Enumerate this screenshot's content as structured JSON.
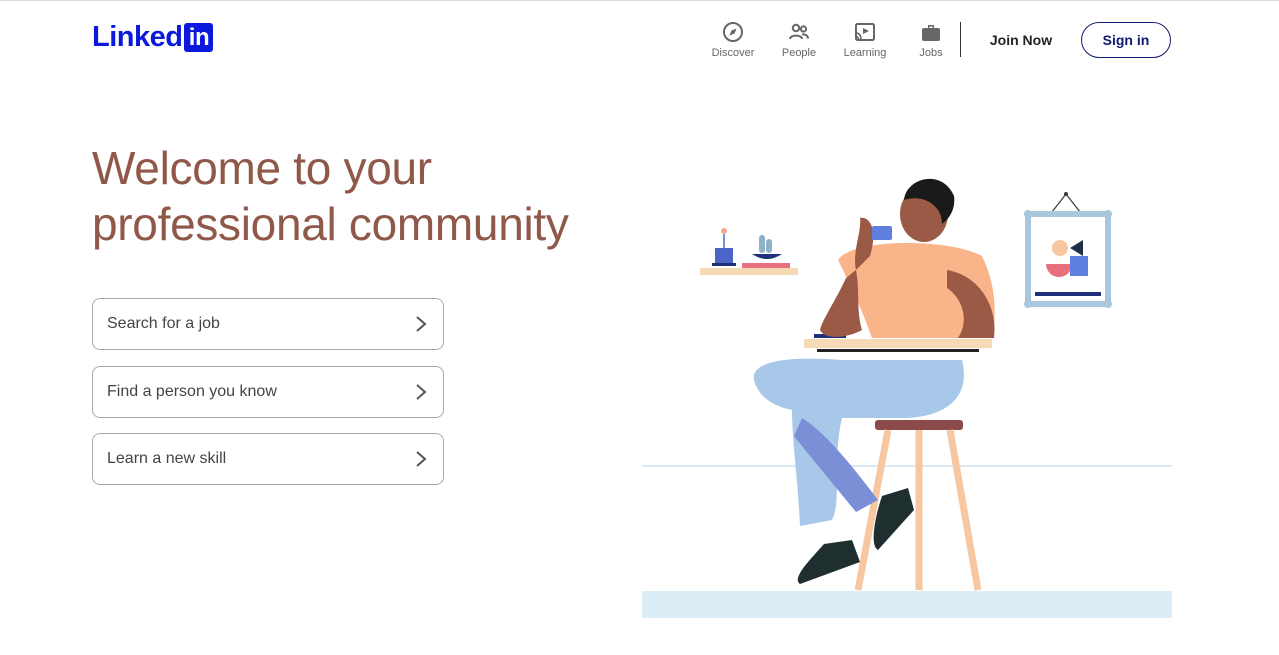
{
  "header": {
    "logo_text": "Linked",
    "logo_box": "in",
    "nav": [
      {
        "label": "Discover",
        "icon": "compass-icon"
      },
      {
        "label": "People",
        "icon": "people-icon"
      },
      {
        "label": "Learning",
        "icon": "learning-icon"
      },
      {
        "label": "Jobs",
        "icon": "briefcase-icon"
      }
    ],
    "join_label": "Join Now",
    "signin_label": "Sign in"
  },
  "hero": {
    "title_line1": "Welcome to your",
    "title_line2": "professional community",
    "options": [
      {
        "label": "Search for a job"
      },
      {
        "label": "Find a person you know"
      },
      {
        "label": "Learn a new skill"
      }
    ]
  },
  "colors": {
    "brand": "#0a19dc",
    "title": "#8f5849",
    "signin_border": "#101a6e"
  }
}
